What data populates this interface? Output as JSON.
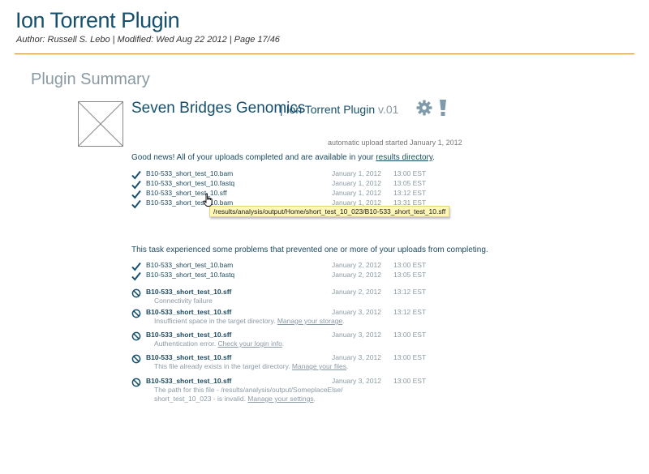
{
  "doc": {
    "title": "Ion Torrent Plugin",
    "meta": "Author: Russell S. Lebo  |  Modified: Wed Aug 22 2012  |  Page 17/46"
  },
  "section_title": "Plugin Summary",
  "app": {
    "name": "Seven Bridges Genomics",
    "separator": "|",
    "plugin": "Ion Torrent Plugin",
    "version": "v.01",
    "icons": [
      "gear-icon",
      "alert-icon"
    ]
  },
  "auto_upload": "automatic upload started January 1, 2012",
  "success": {
    "message_prefix": "Good news! All of your uploads completed and are available in your ",
    "link": "results directory",
    "message_suffix": ".",
    "rows": [
      {
        "file": "B10-533_short_test_10.bam",
        "date": "January 1, 2012",
        "time": "13:00 EST"
      },
      {
        "file": "B10-533_short_test_10.fastq",
        "date": "January 1, 2012",
        "time": "13:05 EST"
      },
      {
        "file": "B10-533_short_test_10.sff",
        "date": "January 1, 2012",
        "time": "13:12 EST"
      },
      {
        "file": "B10-533_short_test_10.bam",
        "date": "January 1, 2012",
        "time": "13:31 EST"
      }
    ],
    "tooltip": "/results/analysis/output/Home/short_test_10_023/B10-533_short_test_10.sff"
  },
  "problems": {
    "message": "This task experienced some problems that prevented one or more of your uploads from completing.",
    "ok_rows": [
      {
        "file": "B10-533_short_test_10.bam",
        "date": "January 2, 2012",
        "time": "13:00 EST"
      },
      {
        "file": "B10-533_short_test_10.fastq",
        "date": "January 2, 2012",
        "time": "13:05 EST"
      }
    ],
    "error_rows": [
      {
        "file": "B10-533_short_test_10.sff",
        "date": "January 2, 2012",
        "time": "13:12 EST",
        "note": "Connectivity failure",
        "note_link": "",
        "note_end": ""
      },
      {
        "file": "B10-533_short_test_10.sff",
        "date": "January 3, 2012",
        "time": "13:12 EST",
        "note": "Insufficient space in the target directory. ",
        "note_link": "Manage your storage",
        "note_end": "."
      },
      {
        "file": "B10-533_short_test_10.sff",
        "date": "January 3, 2012",
        "time": "13:00 EST",
        "note": "Authentication error. ",
        "note_link": "Check your login info",
        "note_end": "."
      },
      {
        "file": "B10-533_short_test_10.sff",
        "date": "January 3, 2012",
        "time": "13:00 EST",
        "note": "This file already exists in the target directory. ",
        "note_link": "Manage your files",
        "note_end": "."
      },
      {
        "file": "B10-533_short_test_10.sff",
        "date": "January 3, 2012",
        "time": "13:00 EST",
        "note": "The path for this file - /results/analysis/output/SomeplaceElse/",
        "note2": "short_test_10_023 - is invalid. ",
        "note_link": "Manage your settings",
        "note_end": "."
      }
    ]
  },
  "colors": {
    "accent": "#d9822b",
    "primary": "#16506e",
    "muted": "#8a9aa3",
    "tooltip": "#fff7b8"
  }
}
